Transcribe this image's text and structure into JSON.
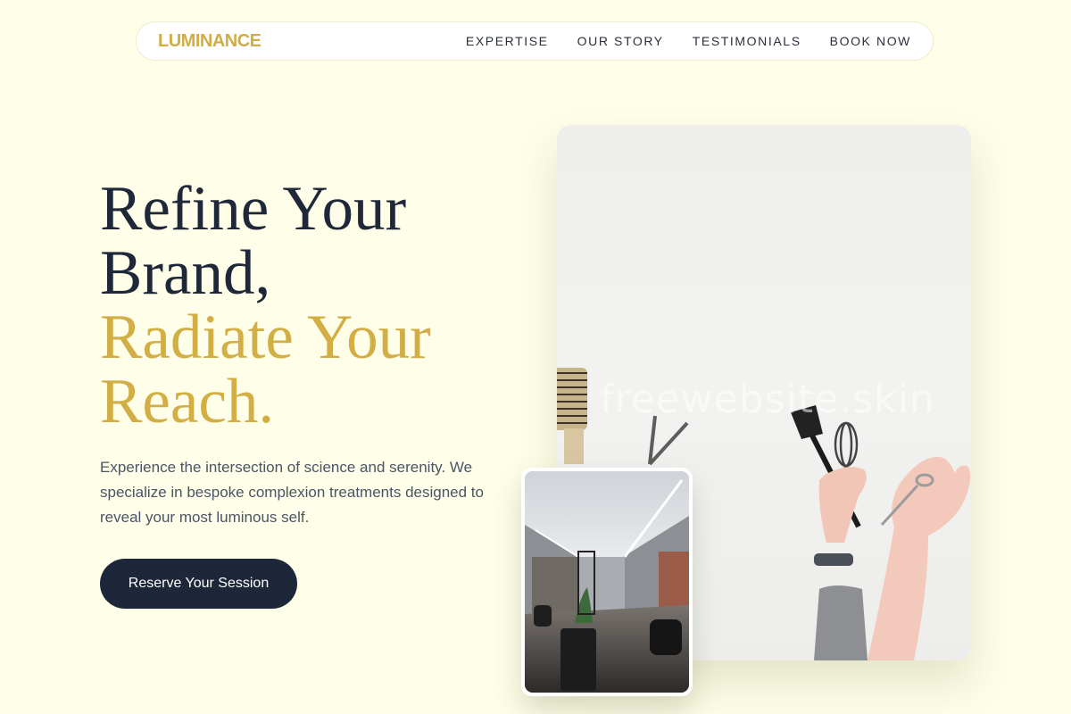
{
  "brand": {
    "logo": "LUMINANCE",
    "accent_color": "#d2ae45",
    "dark_color": "#1f2839"
  },
  "nav": {
    "links": [
      "EXPERTISE",
      "OUR STORY",
      "TESTIMONIALS",
      "BOOK NOW"
    ]
  },
  "hero": {
    "title_lines": [
      "Refine Your",
      "Brand,"
    ],
    "accent_lines": [
      "Radiate Your",
      "Reach."
    ],
    "description": "Experience the intersection of science and serenity. We specialize in bespoke complexion treatments designed to reveal your most luminous self.",
    "cta_label": "Reserve Your Session"
  },
  "images": {
    "main_watermark": "freewebsite.skin",
    "main_icons": [
      "brush-icon",
      "scissors-icon",
      "comb-icon",
      "whisk-icon"
    ],
    "inset_subject": "salon-interior"
  }
}
